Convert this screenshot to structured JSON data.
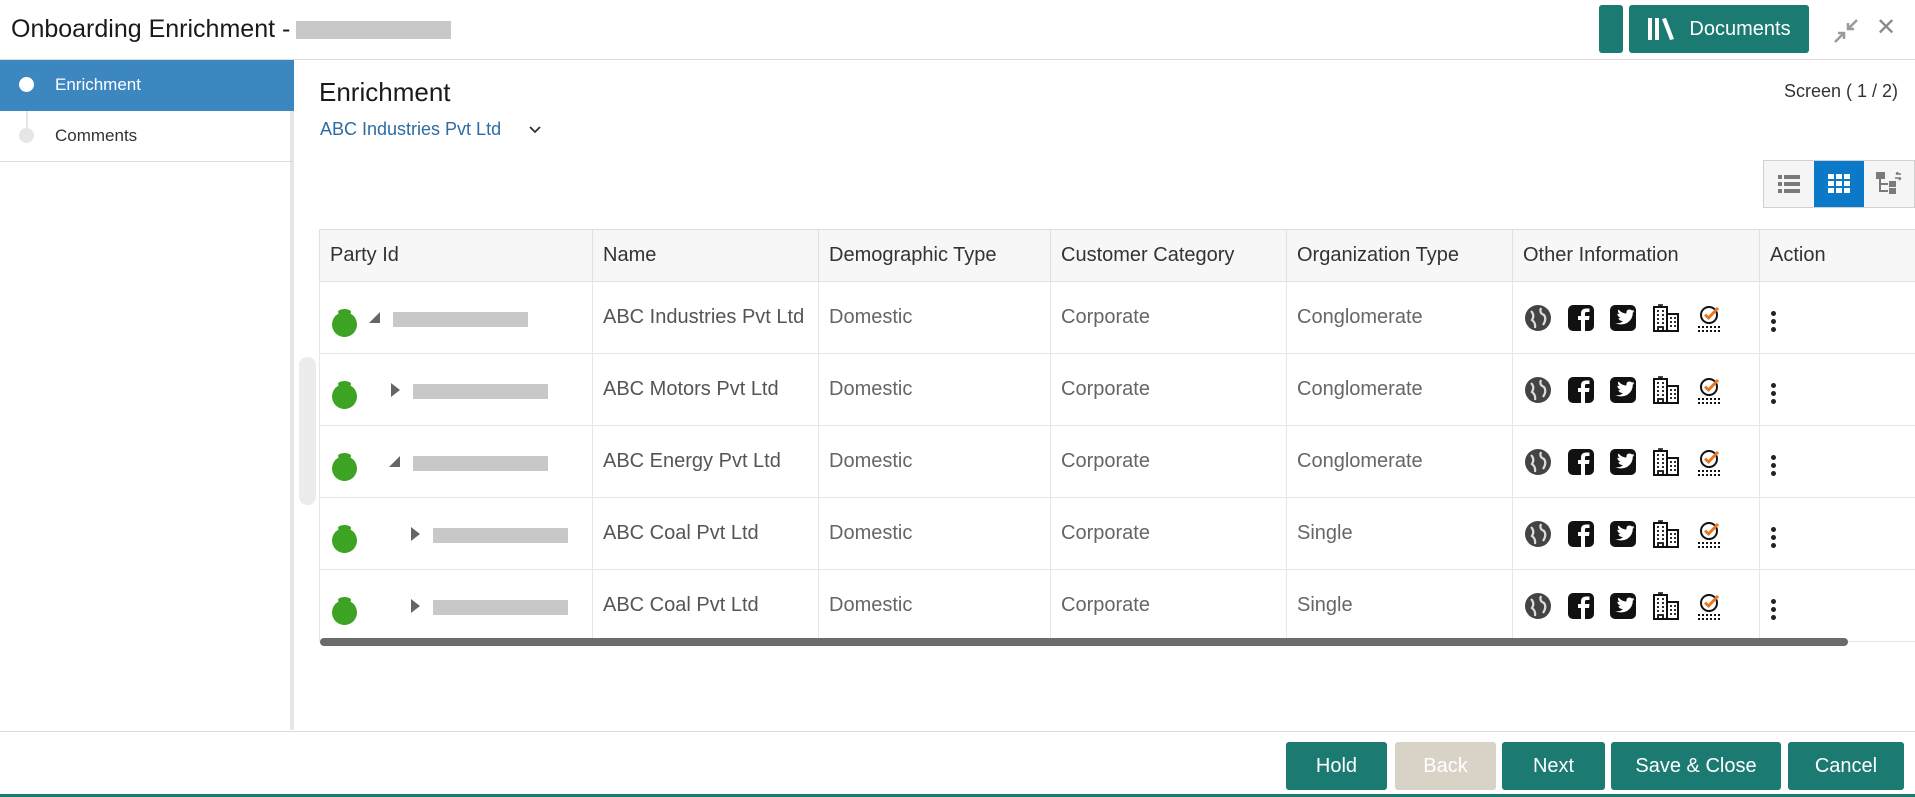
{
  "header": {
    "title": "Onboarding Enrichment -",
    "documents_label": "Documents"
  },
  "sidebar": {
    "items": [
      {
        "label": "Enrichment",
        "active": true
      },
      {
        "label": "Comments",
        "active": false
      }
    ]
  },
  "main": {
    "title": "Enrichment",
    "screen_indicator": "Screen ( 1 / 2)",
    "party_selector": "ABC Industries Pvt Ltd"
  },
  "table": {
    "columns": [
      "Party Id",
      "Name",
      "Demographic Type",
      "Customer Category",
      "Organization Type",
      "Other Information",
      "Action"
    ],
    "rows": [
      {
        "name": "ABC Industries Pvt Ltd",
        "demographic": "Domestic",
        "category": "Corporate",
        "org_type": "Conglomerate",
        "level": 0,
        "expanded": true
      },
      {
        "name": "ABC Motors Pvt Ltd",
        "demographic": "Domestic",
        "category": "Corporate",
        "org_type": "Conglomerate",
        "level": 1,
        "expanded": false
      },
      {
        "name": "ABC Energy Pvt Ltd",
        "demographic": "Domestic",
        "category": "Corporate",
        "org_type": "Conglomerate",
        "level": 1,
        "expanded": true
      },
      {
        "name": "ABC Coal Pvt Ltd",
        "demographic": "Domestic",
        "category": "Corporate",
        "org_type": "Single",
        "level": 2,
        "expanded": false
      },
      {
        "name": "ABC Coal Pvt Ltd",
        "demographic": "Domestic",
        "category": "Corporate",
        "org_type": "Single",
        "level": 2,
        "expanded": false
      }
    ],
    "info_icons": [
      "globe-icon",
      "facebook-icon",
      "twitter-icon",
      "building-icon",
      "checklist-icon"
    ]
  },
  "footer": {
    "hold": "Hold",
    "back": "Back",
    "next": "Next",
    "save_close": "Save & Close",
    "cancel": "Cancel"
  },
  "colors": {
    "accent": "#1b7a72",
    "sidebar_active": "#3d87c1",
    "status_green": "#3ca323",
    "link_blue": "#2d6ca2"
  }
}
